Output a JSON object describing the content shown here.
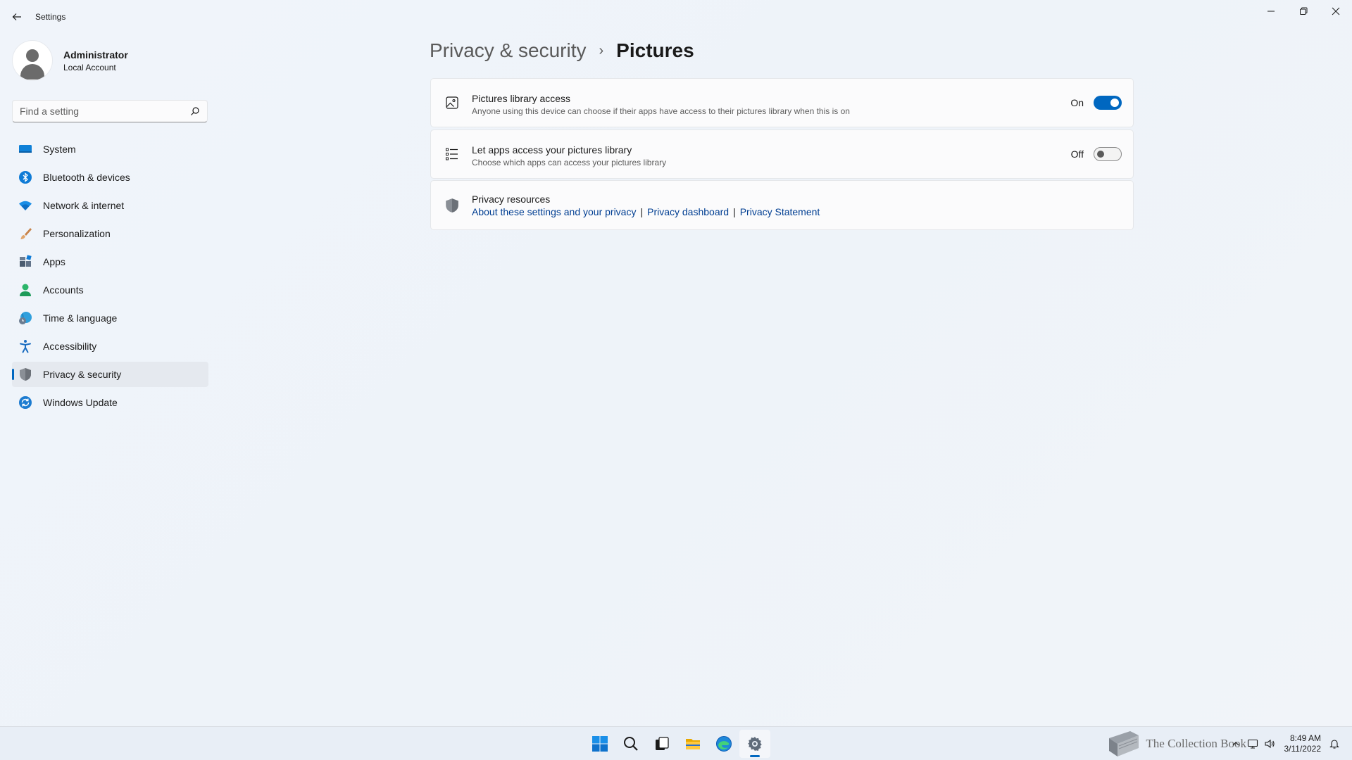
{
  "window": {
    "title": "Settings",
    "controls": [
      "minimize",
      "restore",
      "close"
    ]
  },
  "account": {
    "name": "Administrator",
    "type": "Local Account"
  },
  "search": {
    "placeholder": "Find a setting"
  },
  "sidebar": {
    "items": [
      {
        "label": "System",
        "icon": "system-icon",
        "active": false
      },
      {
        "label": "Bluetooth & devices",
        "icon": "bluetooth-icon",
        "active": false
      },
      {
        "label": "Network & internet",
        "icon": "wifi-icon",
        "active": false
      },
      {
        "label": "Personalization",
        "icon": "brush-icon",
        "active": false
      },
      {
        "label": "Apps",
        "icon": "apps-icon",
        "active": false
      },
      {
        "label": "Accounts",
        "icon": "accounts-icon",
        "active": false
      },
      {
        "label": "Time & language",
        "icon": "globe-clock-icon",
        "active": false
      },
      {
        "label": "Accessibility",
        "icon": "accessibility-icon",
        "active": false
      },
      {
        "label": "Privacy & security",
        "icon": "shield-icon",
        "active": true
      },
      {
        "label": "Windows Update",
        "icon": "update-icon",
        "active": false
      }
    ]
  },
  "breadcrumb": {
    "parent": "Privacy & security",
    "separator": "›",
    "current": "Pictures"
  },
  "settings": [
    {
      "title": "Pictures library access",
      "description": "Anyone using this device can choose if their apps have access to their pictures library when this is on",
      "toggle_label": "On",
      "toggle_state": true,
      "icon": "picture-icon"
    },
    {
      "title": "Let apps access your pictures library",
      "description": "Choose which apps can access your pictures library",
      "toggle_label": "Off",
      "toggle_state": false,
      "icon": "list-icon"
    }
  ],
  "privacy_resources": {
    "title": "Privacy resources",
    "icon": "shield-icon",
    "links": [
      "About these settings and your privacy",
      "Privacy dashboard",
      "Privacy Statement"
    ],
    "separator": "|"
  },
  "taskbar": {
    "apps": [
      "start-icon",
      "search-icon",
      "task-view-icon",
      "file-explorer-icon",
      "edge-icon",
      "settings-icon"
    ],
    "active_app": "settings-icon",
    "watermark": "The Collection Book",
    "time": "8:49 AM",
    "date": "3/11/2022"
  },
  "colors": {
    "accent": "#0067c0",
    "link": "#003e92"
  }
}
